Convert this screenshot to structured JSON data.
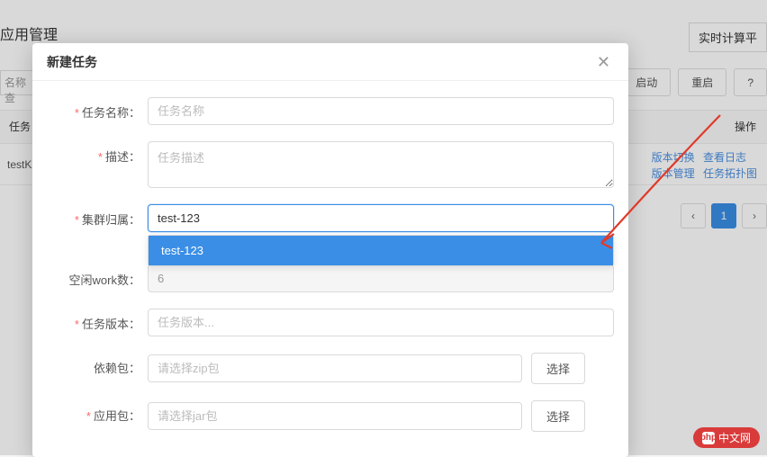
{
  "page": {
    "title": "应用管理",
    "top_button": "实时计算平",
    "search_placeholder": "名称查",
    "buttons": {
      "start": "启动",
      "restart": "重启",
      "more": "?"
    }
  },
  "table": {
    "head_task": "任务",
    "head_ops": "操作",
    "row1": {
      "name": "testK",
      "link1": "版本切换",
      "link2": "查看日志",
      "link3": "版本管理",
      "link4": "任务拓扑图"
    }
  },
  "pager": {
    "prev": "‹",
    "current": "1",
    "next": "›"
  },
  "modal": {
    "title": "新建任务",
    "labels": {
      "task_name": "任务名称：",
      "desc": "描述：",
      "cluster": "集群归属：",
      "workers": "空闲work数：",
      "version": "任务版本：",
      "dep_pkg": "依赖包：",
      "app_pkg": "应用包："
    },
    "placeholders": {
      "task_name": "任务名称",
      "desc": "任务描述",
      "version": "任务版本...",
      "dep_pkg": "请选择zip包",
      "app_pkg": "请选择jar包"
    },
    "values": {
      "cluster": "test-123",
      "workers": "6"
    },
    "dropdown_option": "test-123",
    "select_btn": "选择"
  },
  "watermark": "中文网"
}
